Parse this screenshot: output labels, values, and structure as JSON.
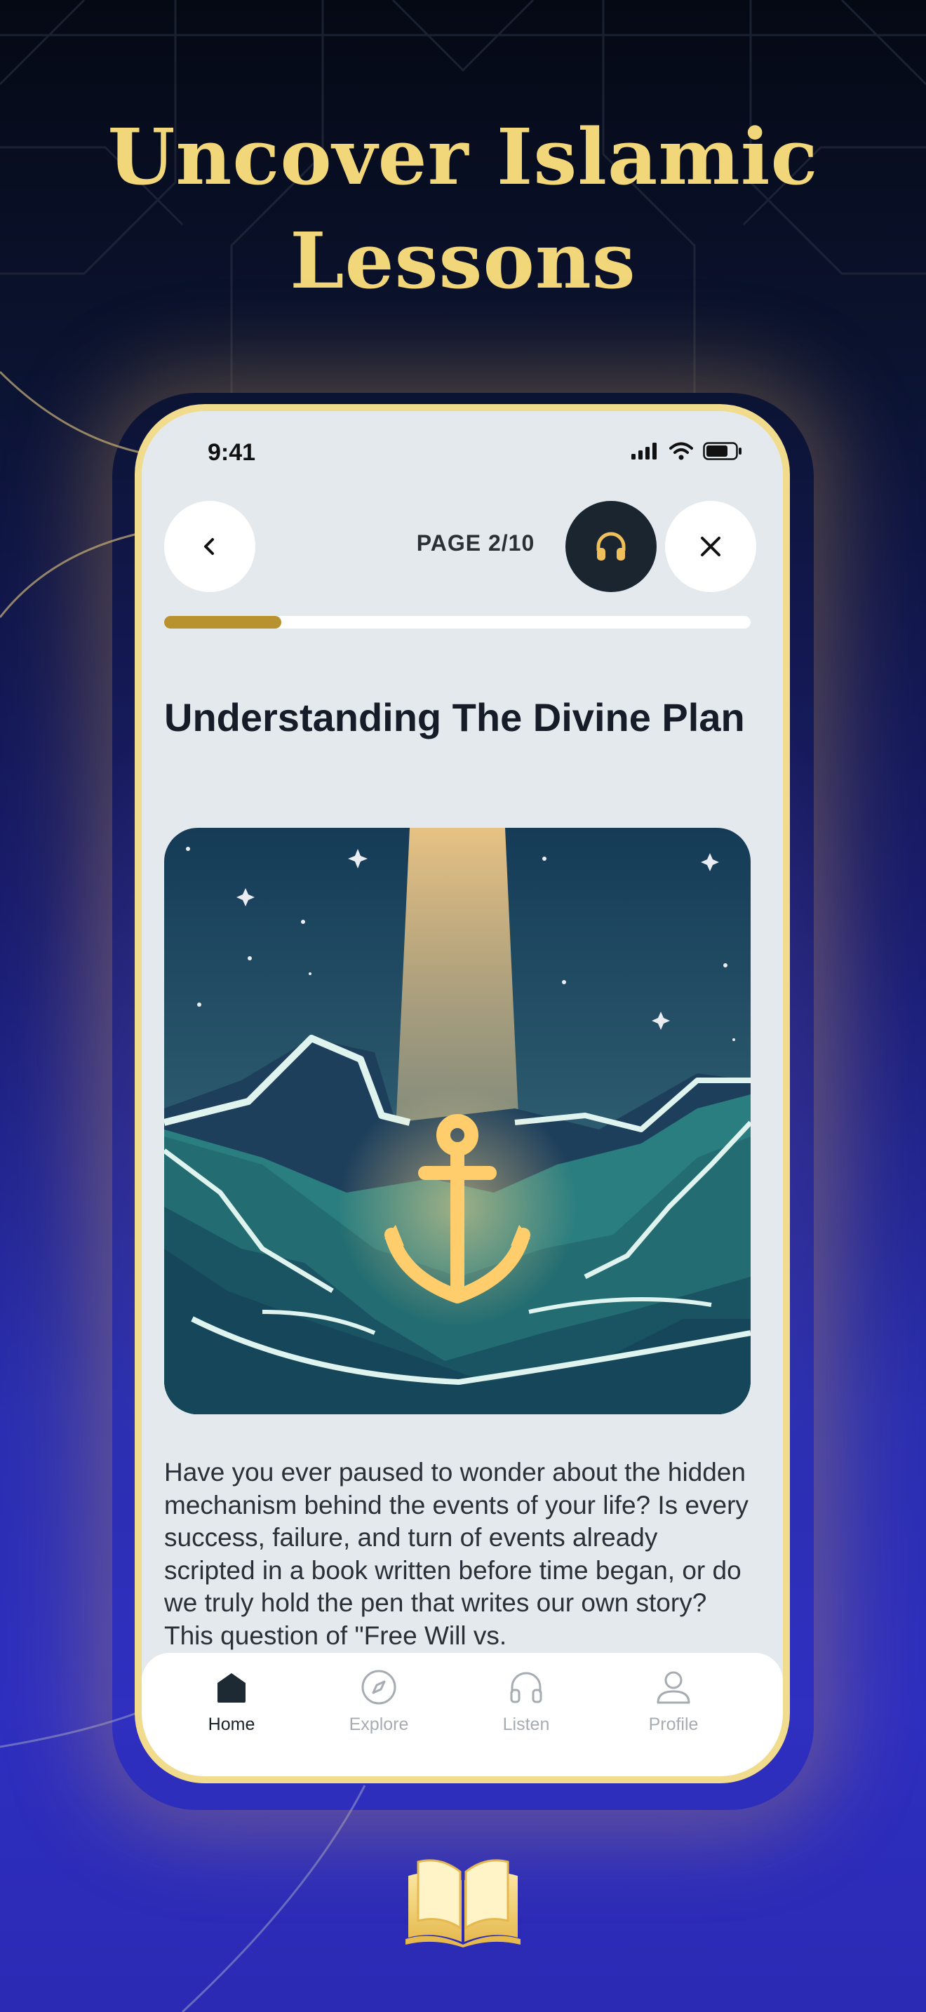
{
  "headline": {
    "line1": "Uncover Islamic",
    "line2": "Lessons"
  },
  "status_bar": {
    "time": "9:41"
  },
  "header": {
    "page_label": "PAGE 2/10"
  },
  "progress": {
    "value": 0.2
  },
  "lesson": {
    "title": "Understanding The Divine Plan",
    "body": "Have you ever paused to wonder about the hidden mechanism behind the events of your life? Is every success, failure, and turn of events already scripted in a book written before time began, or do we truly hold the pen that writes our own story? This question of \"Free Will vs."
  },
  "tabs": [
    {
      "label": "Home",
      "icon": "home-icon",
      "active": true
    },
    {
      "label": "Explore",
      "icon": "compass-icon",
      "active": false
    },
    {
      "label": "Listen",
      "icon": "headphones-icon",
      "active": false
    },
    {
      "label": "Profile",
      "icon": "user-icon",
      "active": false
    }
  ],
  "colors": {
    "gold": "#f2d67a",
    "progress": "#b8922e",
    "dark_button": "#1b2530",
    "phone_frame": "#f1db8c"
  }
}
